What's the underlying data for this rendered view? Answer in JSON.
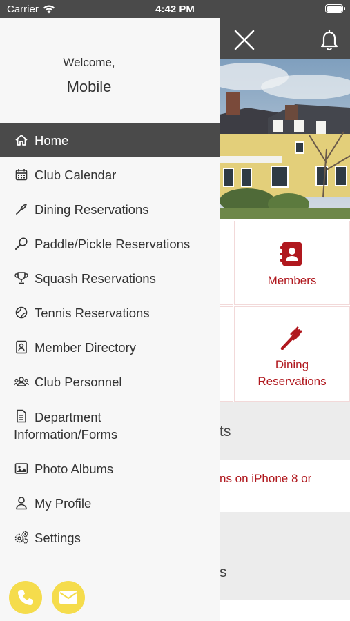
{
  "status_bar": {
    "carrier": "Carrier",
    "time": "4:42 PM"
  },
  "drawer": {
    "welcome": "Welcome,",
    "username": "Mobile",
    "menu": [
      {
        "label": "Home",
        "icon": "home-icon",
        "active": true
      },
      {
        "label": "Club Calendar",
        "icon": "calendar-icon"
      },
      {
        "label": "Dining Reservations",
        "icon": "fork-icon"
      },
      {
        "label": "Paddle/Pickle Reservations",
        "icon": "paddle-icon"
      },
      {
        "label": "Squash Reservations",
        "icon": "trophy-icon"
      },
      {
        "label": "Tennis Reservations",
        "icon": "tennis-ball-icon"
      },
      {
        "label": "Member Directory",
        "icon": "contacts-icon"
      },
      {
        "label": "Club Personnel",
        "icon": "people-icon"
      },
      {
        "label": "Department Information/Forms",
        "icon": "document-icon"
      },
      {
        "label": "Photo Albums",
        "icon": "image-icon"
      },
      {
        "label": "My Profile",
        "icon": "user-icon"
      },
      {
        "label": "Settings",
        "icon": "gears-icon"
      }
    ]
  },
  "tiles": {
    "members": "Members",
    "dining_line1": "Dining",
    "dining_line2": "Reservations"
  },
  "background": {
    "section1_partial": "ts",
    "news_partial": "ns on iPhone 8 or",
    "section2_partial": "s"
  },
  "colors": {
    "header": "#4a4a4a",
    "accent_red": "#b0181e",
    "fab_yellow": "#f5dc4c"
  }
}
